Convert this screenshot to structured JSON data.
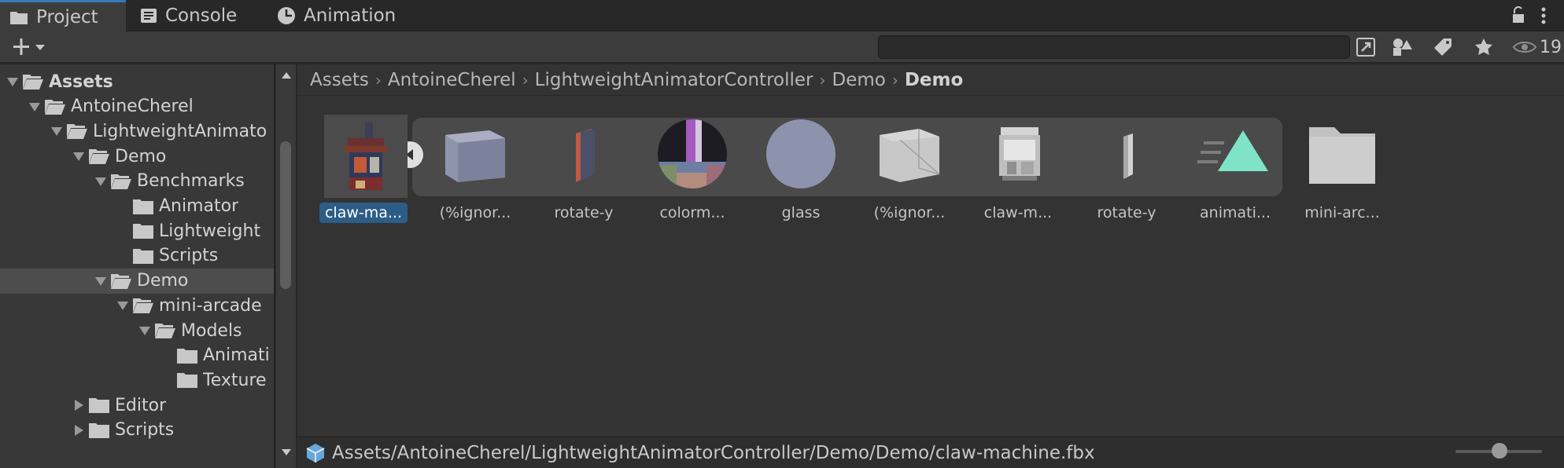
{
  "tabs": [
    {
      "label": "Project",
      "icon": "folder-icon",
      "active": true
    },
    {
      "label": "Console",
      "icon": "console-icon",
      "active": false
    },
    {
      "label": "Animation",
      "icon": "clock-icon",
      "active": false
    }
  ],
  "toolbar": {
    "search_value": "",
    "hidden_count": "19"
  },
  "tree": [
    {
      "label": "Assets",
      "depth": 0,
      "expanded": true,
      "bold": true
    },
    {
      "label": "AntoineCherel",
      "depth": 1,
      "expanded": true
    },
    {
      "label": "LightweightAnimato",
      "depth": 2,
      "expanded": true
    },
    {
      "label": "Demo",
      "depth": 3,
      "expanded": true
    },
    {
      "label": "Benchmarks",
      "depth": 4,
      "expanded": true
    },
    {
      "label": "Animator",
      "depth": 5,
      "leaf": true
    },
    {
      "label": "Lightweight",
      "depth": 5,
      "leaf": true
    },
    {
      "label": "Scripts",
      "depth": 5,
      "leaf": true
    },
    {
      "label": "Demo",
      "depth": 4,
      "expanded": true,
      "selected": true
    },
    {
      "label": "mini-arcade",
      "depth": 5,
      "expanded": true
    },
    {
      "label": "Models",
      "depth": 6,
      "expanded": true
    },
    {
      "label": "Animati",
      "depth": 7,
      "leaf": true
    },
    {
      "label": "Texture",
      "depth": 7,
      "leaf": true
    },
    {
      "label": "Editor",
      "depth": 3,
      "expanded": false
    },
    {
      "label": "Scripts",
      "depth": 3,
      "expanded": false
    }
  ],
  "breadcrumb": [
    "Assets",
    "AntoineCherel",
    "LightweightAnimatorController",
    "Demo",
    "Demo"
  ],
  "assets": [
    {
      "label": "claw-ma...",
      "kind": "claw-model",
      "selected": true
    },
    {
      "label": "(%ignor...",
      "kind": "box-mesh"
    },
    {
      "label": "rotate-y",
      "kind": "slab-mesh"
    },
    {
      "label": "colorm...",
      "kind": "color-sphere"
    },
    {
      "label": "glass",
      "kind": "glass-sphere"
    },
    {
      "label": "(%ignor...",
      "kind": "plane-mesh"
    },
    {
      "label": "claw-m...",
      "kind": "claw-grey"
    },
    {
      "label": "rotate-y",
      "kind": "thin-slab"
    },
    {
      "label": "animati...",
      "kind": "animation-clip"
    },
    {
      "label": "mini-arc...",
      "kind": "folder"
    }
  ],
  "status_path": "Assets/AntoineCherel/LightweightAnimatorController/Demo/Demo/claw-machine.fbx",
  "colors": {
    "accent": "#3a79bb",
    "selection": "#2c5d87",
    "animation": "#7fe3c8"
  }
}
